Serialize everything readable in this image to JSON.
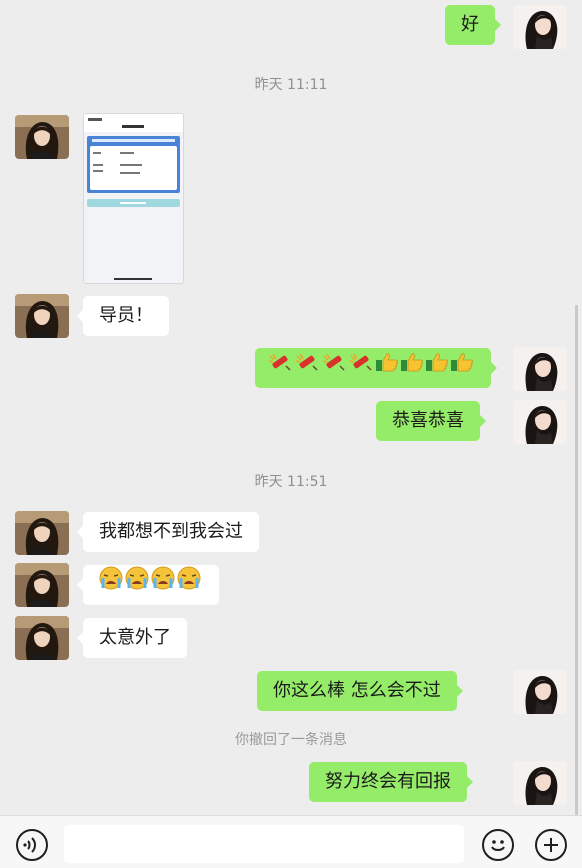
{
  "chat": {
    "messages": [
      {
        "side": "out",
        "text": "好"
      },
      {
        "type": "time",
        "text": "昨天 11:11"
      },
      {
        "side": "in",
        "type": "image"
      },
      {
        "side": "in",
        "text": "导员！"
      },
      {
        "side": "out",
        "type": "emoji",
        "emoji": [
          "firecracker",
          "firecracker",
          "firecracker",
          "firecracker",
          "thumbs-up",
          "thumbs-up",
          "thumbs-up",
          "thumbs-up"
        ]
      },
      {
        "side": "out",
        "text": "恭喜恭喜"
      },
      {
        "type": "time",
        "text": "昨天 11:51"
      },
      {
        "side": "in",
        "text": "我都想不到我会过"
      },
      {
        "side": "in",
        "type": "emoji",
        "emoji": [
          "crying-face",
          "crying-face",
          "crying-face",
          "crying-face"
        ]
      },
      {
        "side": "in",
        "text": "太意外了"
      },
      {
        "side": "out",
        "text": "你这么棒 怎么会不过"
      },
      {
        "type": "system",
        "text": "你撤回了一条消息"
      },
      {
        "side": "out",
        "text": "努力终会有回报"
      }
    ]
  },
  "input_bar": {
    "voice_icon": "voice-icon",
    "emoji_icon": "smiley-icon",
    "more_icon": "plus-icon",
    "input_value": ""
  },
  "colors": {
    "background": "#ededed",
    "out_bubble": "#95ec69",
    "in_bubble": "#ffffff",
    "time_text": "#8f8f8f"
  }
}
